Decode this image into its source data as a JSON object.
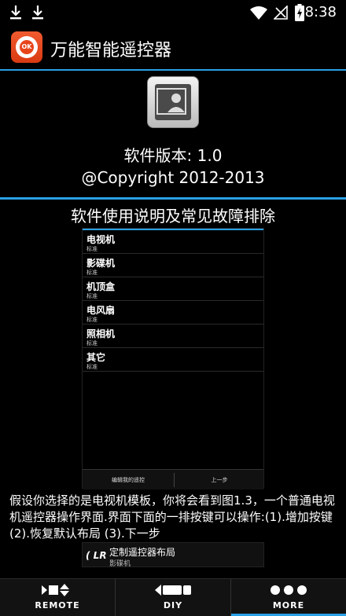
{
  "status_bar": {
    "time": "8:38",
    "icons": [
      "download-icon",
      "download-icon",
      "wifi-icon",
      "no-signal-icon",
      "battery-charging-icon"
    ]
  },
  "app_bar": {
    "icon_text": "OK",
    "title": "万能智能遥控器"
  },
  "about": {
    "version": "软件版本: 1.0",
    "copyright": "@Copyright 2012-2013"
  },
  "manual": {
    "section_title": "软件使用说明及常见故障排除",
    "screenshot": {
      "items": [
        {
          "name": "电视机",
          "sub": "标准"
        },
        {
          "name": "影碟机",
          "sub": "标准"
        },
        {
          "name": "机顶盒",
          "sub": "标准"
        },
        {
          "name": "电风扇",
          "sub": "标准"
        },
        {
          "name": "照相机",
          "sub": "标准"
        },
        {
          "name": "其它",
          "sub": "标准"
        }
      ],
      "bottom_left": "编辑我的遥控",
      "bottom_right": "上一步"
    },
    "description": "假设你选择的是电视机模板，你将会看到图1.3，一个普通电视机遥控器操作界面.界面下面的一排按键可以操作:(1).增加按键 (2).恢复默认布局 (3).下一步",
    "partial_item": {
      "icon_text": "LR",
      "title": "定制遥控器布局",
      "sub": "影碟机"
    }
  },
  "bottom_nav": {
    "tabs": [
      {
        "label": "REMOTE",
        "icon": "remote-icon"
      },
      {
        "label": "DIY",
        "icon": "diy-icon"
      },
      {
        "label": "MORE",
        "icon": "more-icon",
        "active": true
      }
    ]
  },
  "colors": {
    "accent": "#2aa0e6",
    "app_icon": "#e8441a",
    "background": "#000000"
  }
}
